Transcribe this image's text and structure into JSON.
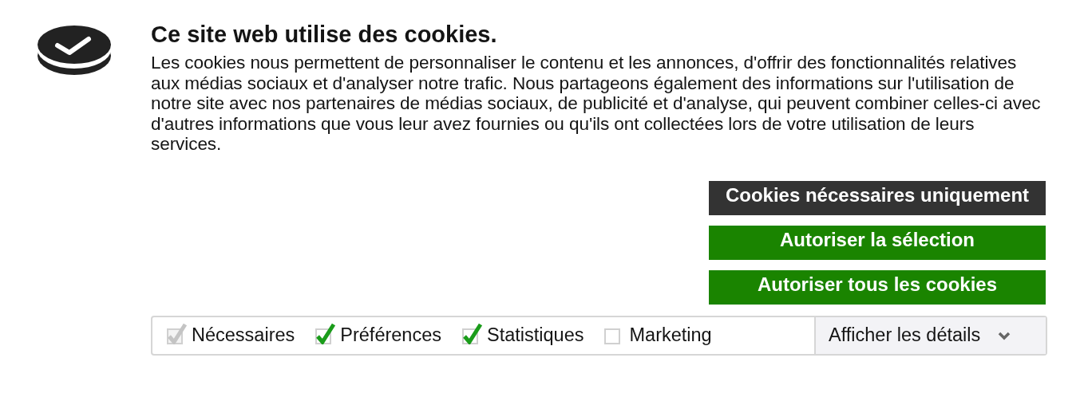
{
  "banner": {
    "title": "Ce site web utilise des cookies.",
    "text": "Les cookies nous permettent de personnaliser le contenu et les annonces, d'offrir des fonctionnalités relatives aux médias sociaux et d'analyser notre trafic. Nous partageons également des informations sur l'utilisation de notre site avec nos partenaires de médias sociaux, de publicité et d'analyse, qui peuvent combiner celles-ci avec d'autres informations que vous leur avez fournies ou qu'ils ont collectées lors de votre utilisation de leurs services."
  },
  "buttons": [
    {
      "label": "Cookies nécessaires uniquement",
      "kind": "dark"
    },
    {
      "label": "Autoriser la sélection",
      "kind": "primary"
    },
    {
      "label": "Autoriser tous les cookies",
      "kind": "primary"
    }
  ],
  "checkboxes": [
    {
      "label": "Nécessaires",
      "checked": true,
      "disabled": true
    },
    {
      "label": "Préférences",
      "checked": true,
      "disabled": false
    },
    {
      "label": "Statistiques",
      "checked": true,
      "disabled": false
    },
    {
      "label": "Marketing",
      "checked": false,
      "disabled": false
    }
  ],
  "details_toggle": {
    "label": "Afficher les détails",
    "expanded": false
  }
}
